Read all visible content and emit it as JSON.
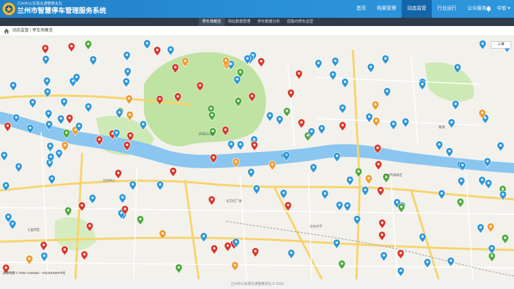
{
  "header": {
    "brand_top": "兰州市公安局交通警察支队",
    "brand_main": "兰州市智慧停车管理服务系统",
    "nav": [
      {
        "label": "首页",
        "active": false
      },
      {
        "label": "档案管理",
        "active": false
      },
      {
        "label": "动态监管",
        "active": true
      },
      {
        "label": "行业运行",
        "active": false
      },
      {
        "label": "公众服务",
        "active": false
      }
    ],
    "user": "中软"
  },
  "subnav": {
    "tabs": [
      {
        "label": "停车场概览",
        "active": true
      },
      {
        "label": "场站数据管理",
        "active": false
      },
      {
        "label": "停车数据分析",
        "active": false
      },
      {
        "label": "道路内停车运营",
        "active": false
      }
    ]
  },
  "breadcrumb": {
    "path": "动态监管 / 停车场概览"
  },
  "map": {
    "legend_label": "三维",
    "attribution": "高德地图 © 2020 AutoNavi - GS(2019)6379号",
    "labels": [
      {
        "text": "兰州市城关区"
      },
      {
        "text": "黄河"
      },
      {
        "text": "兰州大学"
      },
      {
        "text": "东方红广场"
      },
      {
        "text": "兰州中心"
      },
      {
        "text": "七里河区"
      },
      {
        "text": "雁滩"
      },
      {
        "text": "白塔山公园"
      }
    ],
    "colors": {
      "river": "#8ac6ef",
      "park": "#bfe3a2",
      "road_major": "#f7d36a",
      "road_minor": "#ffffff",
      "pin_blue": "#2c96d8",
      "pin_red": "#d8352a",
      "pin_green": "#4ea83b",
      "pin_orange": "#ee9a2c"
    }
  },
  "footer": {
    "text": "兰州市公安局交通警察支队 © 2019"
  }
}
